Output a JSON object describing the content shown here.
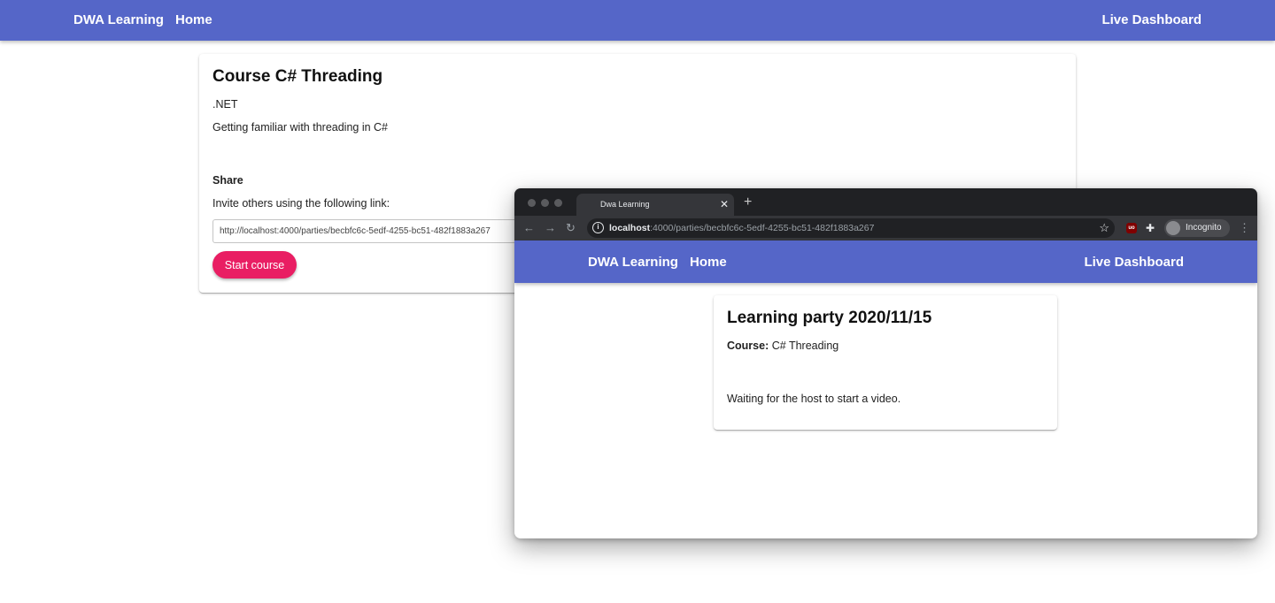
{
  "appbar": {
    "brand": "DWA Learning",
    "home": "Home",
    "live_dashboard": "Live Dashboard"
  },
  "course": {
    "title": "Course C# Threading",
    "category": ".NET",
    "description": "Getting familiar with threading in C#",
    "share_heading": "Share",
    "invite_text": "Invite others using the following link:",
    "invite_link": "http://localhost:4000/parties/becbfc6c-5edf-4255-bc51-482f1883a267",
    "start_button": "Start course"
  },
  "browser": {
    "tab_title": "Dwa Learning",
    "tab_close": "✕",
    "new_tab": "+",
    "url_host": "localhost",
    "url_path": ":4000/parties/becbfc6c-5edf-4255-bc51-482f1883a267",
    "extension_badge": "uo",
    "incognito_label": "Incognito",
    "icons": [
      "back-arrow-icon",
      "forward-arrow-icon",
      "reload-icon",
      "info-icon",
      "star-icon",
      "puzzle-icon",
      "menu-dots-icon"
    ]
  },
  "inner_app": {
    "brand": "DWA Learning",
    "home": "Home",
    "live_dashboard": "Live Dashboard"
  },
  "party": {
    "title": "Learning party 2020/11/15",
    "course_label": "Course:",
    "course_value": "C# Threading",
    "waiting_text": "Waiting for the host to start a video."
  },
  "colors": {
    "appbar": "#5566c8",
    "start_button": "#e91e63",
    "browser_chrome": "#202124",
    "browser_toolbar": "#35363a"
  }
}
